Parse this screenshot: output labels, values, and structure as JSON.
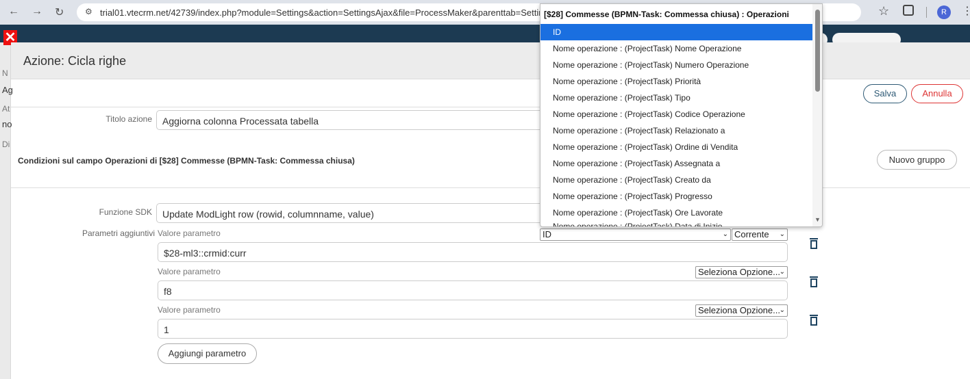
{
  "browser": {
    "url": "trial01.vtecrm.net/42739/index.php?module=Settings&action=SettingsAjax&file=ProcessMaker&parenttab=Settings",
    "profile_initial": "R"
  },
  "background_app": {
    "strip_letters": [
      "N",
      "Ag",
      "At",
      "no",
      "Di"
    ]
  },
  "modal": {
    "title": "Azione: Cicla righe",
    "save_label": "Salva",
    "cancel_label": "Annulla",
    "action_title_label": "Titolo azione",
    "action_title_value": "Aggiorna colonna Processata tabella",
    "conditions_title": "Condizioni sul campo Operazioni di [$28] Commesse (BPMN-Task: Commessa chiusa)",
    "new_group_label": "Nuovo gruppo",
    "sdk_function_label": "Funzione SDK",
    "sdk_function_value": "Update ModLight row (rowid, columnname, value)",
    "extra_params_label": "Parametri aggiuntivi",
    "params": [
      {
        "label": "Valore parametro",
        "select_value": "ID",
        "select2_value": "Corrente",
        "value": "$28-ml3::crmid:curr"
      },
      {
        "label": "Valore parametro",
        "select_value": "Seleziona Opzione...",
        "value": "f8"
      },
      {
        "label": "Valore parametro",
        "select_value": "Seleziona Opzione...",
        "value": "1"
      }
    ],
    "add_param_label": "Aggiungi parametro"
  },
  "dropdown": {
    "header": "[$28] Commesse (BPMN-Task: Commessa chiusa) : Operazioni",
    "options": [
      "ID",
      "Nome operazione : (ProjectTask) Nome Operazione",
      "Nome operazione : (ProjectTask) Numero Operazione",
      "Nome operazione : (ProjectTask) Priorità",
      "Nome operazione : (ProjectTask) Tipo",
      "Nome operazione : (ProjectTask) Codice Operazione",
      "Nome operazione : (ProjectTask) Relazionato a",
      "Nome operazione : (ProjectTask) Ordine di Vendita",
      "Nome operazione : (ProjectTask) Assegnata a",
      "Nome operazione : (ProjectTask) Creato da",
      "Nome operazione : (ProjectTask) Progresso",
      "Nome operazione : (ProjectTask) Ore Lavorate",
      "Nome operazione : (ProjectTask) Data di Inizio"
    ],
    "selected_index": 0
  },
  "colors": {
    "accent": "#1a6fe0",
    "save_border": "#2d5975",
    "cancel_border": "#dd3333",
    "header_bg": "#1c3a52"
  }
}
